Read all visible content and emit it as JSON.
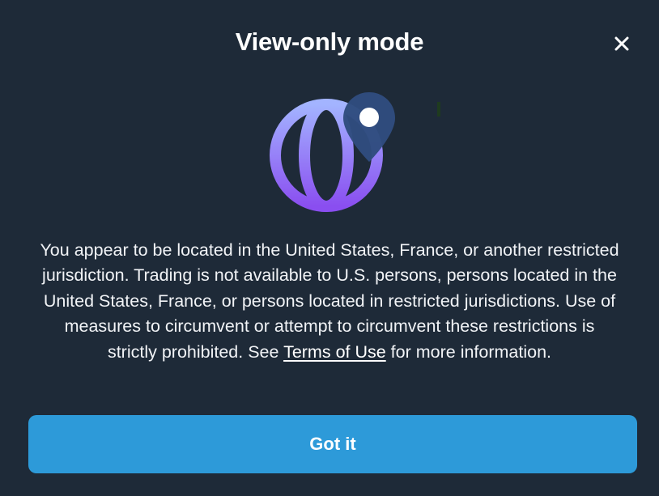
{
  "modal": {
    "title": "View-only mode",
    "close_icon": "close-icon",
    "illustration_icons": [
      "globe-icon",
      "map-pin-icon"
    ],
    "message": {
      "text_before": "You appear to be located in the United States, France, or another restricted jurisdiction. Trading is not available to U.S. persons, persons located in the United States, France, or persons located in restricted jurisdictions. Use of measures to circumvent or attempt to circumvent these restrictions is strictly prohibited. See ",
      "link_label": "Terms of Use",
      "text_after": " for more information."
    },
    "primary_button_label": "Got it"
  },
  "colors": {
    "background": "#1e2a38",
    "button": "#2d9ad9",
    "globe_top": "#9fb0ff",
    "globe_bottom": "#8a4ef0",
    "pin": "#2f4c7f"
  }
}
